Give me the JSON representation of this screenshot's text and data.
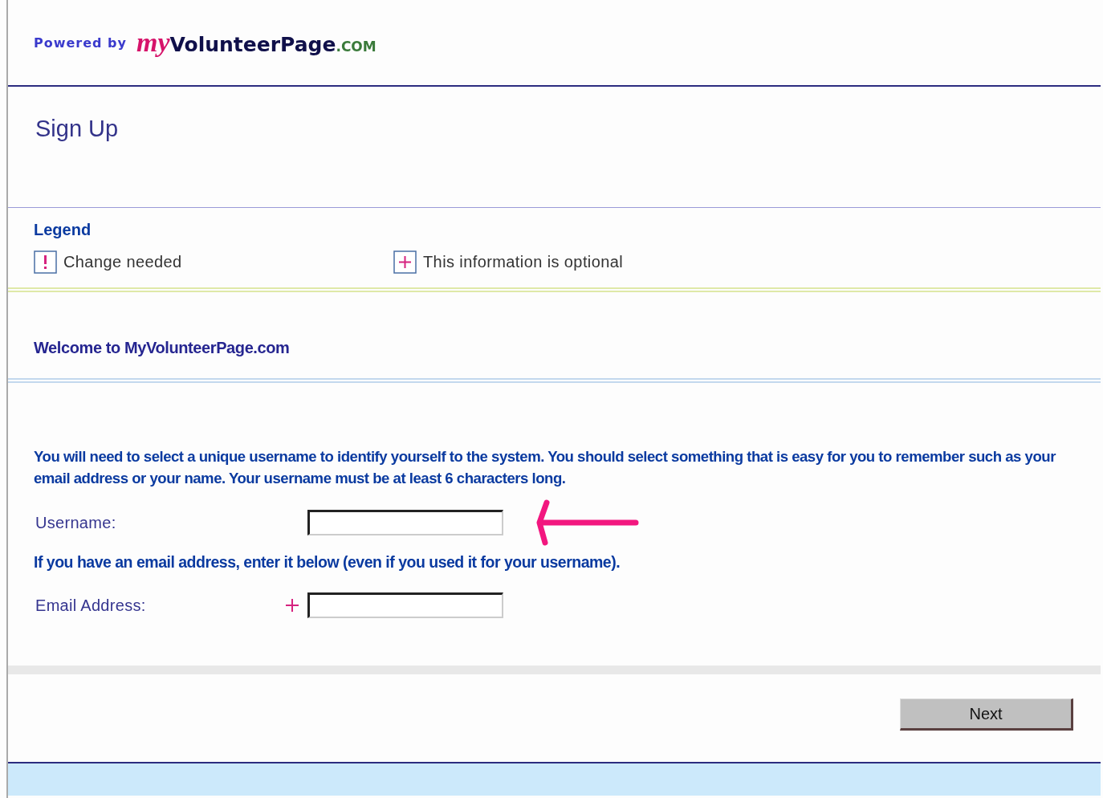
{
  "header": {
    "powered_by": "Powered by",
    "logo": {
      "my": "my",
      "name": "VolunteerPage",
      "suffix": ".COM"
    }
  },
  "page_title": "Sign Up",
  "legend": {
    "title": "Legend",
    "items": [
      {
        "kind": "change",
        "label": "Change needed"
      },
      {
        "kind": "optional",
        "label": "This information is optional"
      }
    ]
  },
  "welcome": "Welcome to MyVolunteerPage.com",
  "form": {
    "intro": "You will need to select a unique username to identify yourself to the system. You should select something that is easy for you to remember such as your email address or your name. Your username must be at least 6 characters long.",
    "fields": [
      {
        "label": "Username:",
        "optional": false,
        "pointer": true
      },
      {
        "note": "If you have an email address, enter it below (even if you used it for your username)."
      },
      {
        "label": "Email Address:",
        "optional": true,
        "pointer": false
      }
    ]
  },
  "buttons": [
    "Next"
  ]
}
